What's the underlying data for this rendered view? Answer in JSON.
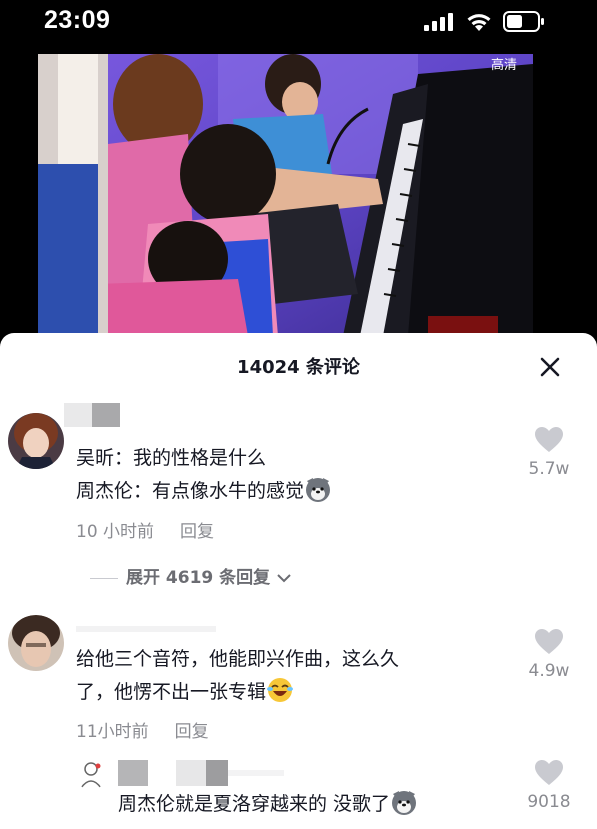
{
  "status_bar": {
    "time": "23:09"
  },
  "video": {
    "quality_tag": "高清"
  },
  "comments_panel": {
    "title": "14024 条评论",
    "comments": [
      {
        "lines": [
          "吴昕：我的性格是什么",
          "周杰伦：有点像水牛的感觉"
        ],
        "time": "10 小时前",
        "reply": "回复",
        "likes": "5.7w",
        "expand": "展开 4619 条回复"
      },
      {
        "lines": [
          "给他三个音符，他能即兴作曲，这么久",
          "了，他愣不出一张专辑"
        ],
        "time": "11小时前",
        "reply": "回复",
        "likes": "4.9w"
      },
      {
        "lines": [
          "周杰伦就是夏洛穿越来的 没歌了"
        ],
        "likes": "9018"
      }
    ]
  }
}
